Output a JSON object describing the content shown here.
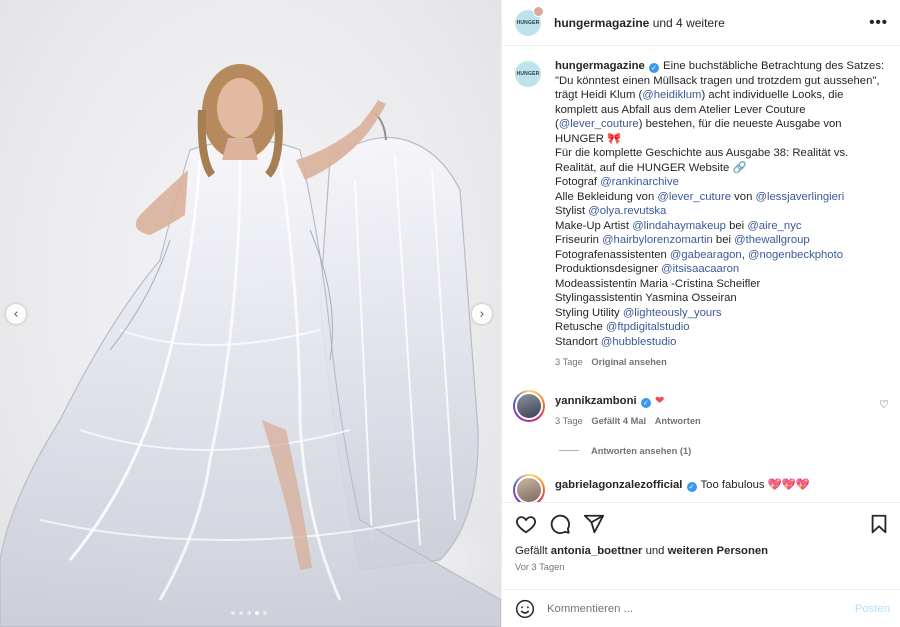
{
  "header": {
    "avatar_text": "HUNGER",
    "username": "hungermagazine",
    "others": "und 4 weitere",
    "more_icon": "more-horizontal-icon"
  },
  "caption": {
    "username": "hungermagazine",
    "text1": "Eine buchstäbliche Betrachtung des Satzes:",
    "text2": "\"Du könntest einen Müllsack tragen und trotzdem gut aussehen\",",
    "text3a": "trägt Heidi Klum (",
    "tag_heidi": "@heidiklum",
    "text3b": ") acht individuelle Looks, die",
    "text4": "komplett aus Abfall aus dem Atelier Lever Couture",
    "text5a": "(",
    "tag_lever": "@lever_couture",
    "text5b": ") bestehen, für die neueste Ausgabe von",
    "text6": "HUNGER",
    "emoji_bow": "🎀",
    "text7": "Für die komplette Geschichte aus Ausgabe 38: Realität vs.",
    "text8": "Realität, auf die HUNGER Website",
    "emoji_link": "🔗",
    "credits": [
      {
        "label": "Fotograf ",
        "tag": "@rankinarchive"
      },
      {
        "label": "Alle Bekleidung von ",
        "tag": "@lever_cuture",
        "mid": " von ",
        "tag2": "@lessjaverlingieri"
      },
      {
        "label": "Stylist ",
        "tag": "@olya.revutska"
      },
      {
        "label": "Make-Up Artist ",
        "tag": "@lindahaymakeup",
        "mid": " bei ",
        "tag2": "@aire_nyc"
      },
      {
        "label": "Friseurin ",
        "tag": "@hairbylorenzomartin",
        "mid": " bei ",
        "tag2": "@thewallgroup"
      },
      {
        "label": "Fotografenassistenten ",
        "tag": "@gabearagon",
        "mid": ", ",
        "tag2": "@nogenbeckphoto"
      },
      {
        "label": "Produktionsdesigner ",
        "tag": "@itsisaacaaron"
      },
      {
        "label": "Modeassistentin Maria -Cristina Scheifler"
      },
      {
        "label": "Stylingassistentin Yasmina Osseiran"
      },
      {
        "label": "Styling Utility ",
        "tag": "@lighteously_yours"
      },
      {
        "label": "Retusche ",
        "tag": "@ftpdigitalstudio"
      },
      {
        "label": "Standort ",
        "tag": "@hubblestudio"
      }
    ],
    "time": "3 Tage",
    "see_original": "Original ansehen"
  },
  "comments": [
    {
      "username": "yannikzamboni",
      "emoji": "❤",
      "time": "3 Tage",
      "likes": "Gefällt 4 Mal",
      "reply": "Antworten",
      "view_replies": "Antworten ansehen (1)"
    },
    {
      "username": "gabrielagonzalezofficial",
      "text": "Too fabulous",
      "emoji": "💖💖💖"
    }
  ],
  "actions": {
    "like_icon": "heart-outline-icon",
    "comment_icon": "comment-icon",
    "share_icon": "paper-plane-icon",
    "save_icon": "bookmark-icon"
  },
  "likes": {
    "prefix": "Gefällt",
    "user": "antonia_boettner",
    "mid": "und",
    "rest": "weiteren Personen"
  },
  "posted": "Vor 3 Tagen",
  "add_comment": {
    "placeholder": "Kommentieren ...",
    "post_label": "Posten"
  },
  "carousel": {
    "prev": "‹",
    "next": "›",
    "slides": 5,
    "active_index": 3
  }
}
